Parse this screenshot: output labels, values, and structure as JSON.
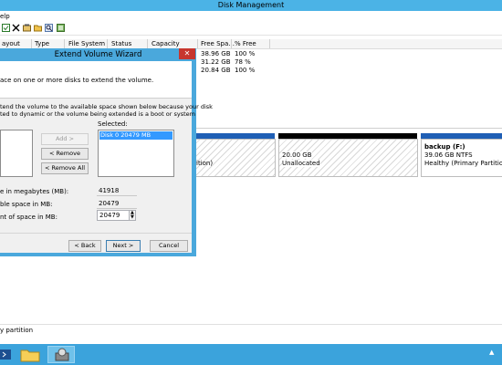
{
  "window": {
    "title": "Disk Management"
  },
  "menu": {
    "help": "elp"
  },
  "volume_table": {
    "headers": [
      "ayout",
      "Type",
      "File System",
      "Status",
      "Capacity",
      "Free Spa...",
      "% Free"
    ],
    "rows": [
      {
        "free": "38.96 GB",
        "pct": "100 %"
      },
      {
        "free": "31.22 GB",
        "pct": "78 %"
      },
      {
        "free": "20.84 GB",
        "pct": "100 %"
      }
    ]
  },
  "disk_view": {
    "partition_left_suffix": "ition)",
    "unallocated_size": "20.00 GB",
    "unallocated_label": "Unallocated",
    "backup_name": "backup  (F:)",
    "backup_size": "39.06 GB NTFS",
    "backup_status": "Healthy (Primary Partition)",
    "colors": {
      "primary": "#1f5fb5",
      "unallocated": "#000000"
    }
  },
  "status_bar": {
    "text": "y partition"
  },
  "wizard": {
    "title": "Extend Volume Wizard",
    "close": "✕",
    "header_text": "ace on one or more disks to extend the volume.",
    "desc_line1": "tend the volume to the available space shown below because your disk",
    "desc_line2": "ted to dynamic or the volume being extended is a boot or system",
    "selected_label": "Selected:",
    "selected_items": [
      "Disk 0     20479 MB"
    ],
    "add_button": "Add >",
    "remove_button": "< Remove",
    "remove_all_button": "< Remove All",
    "total_label": "e in megabytes (MB):",
    "total_value": "41918",
    "max_label": "ble space in MB:",
    "max_value": "20479",
    "amount_label": "nt of space in MB:",
    "amount_value": "20479",
    "back_button": "< Back",
    "next_button": "Next >",
    "cancel_button": "Cancel"
  }
}
